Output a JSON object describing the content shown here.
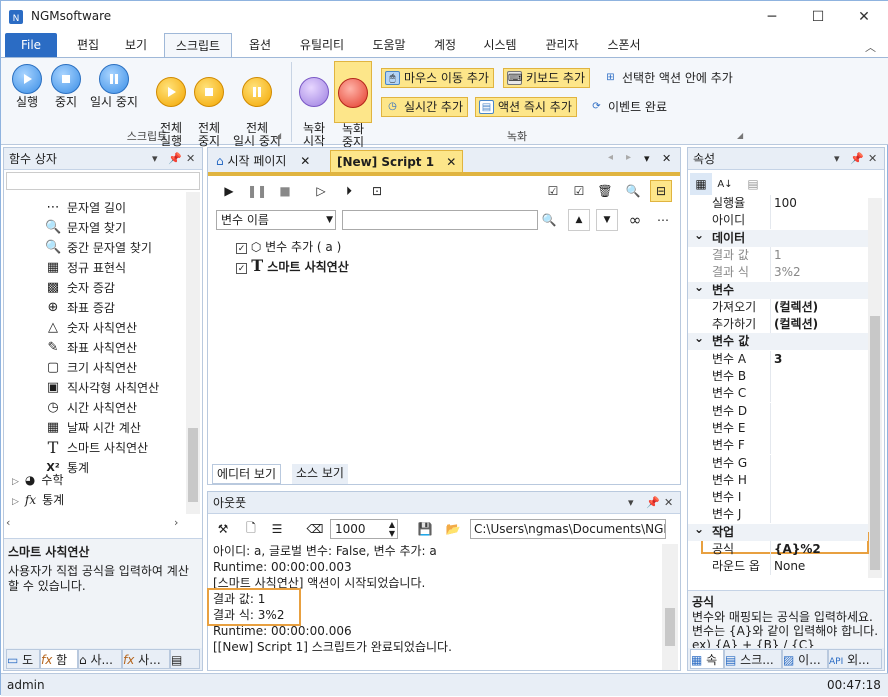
{
  "app": {
    "title": "NGMsoftware",
    "min_icon": "minimize-icon",
    "max_icon": "maximize-icon",
    "close_icon": "close-icon"
  },
  "menu": {
    "items": [
      "File",
      "편집",
      "보기",
      "스크립트",
      "옵션",
      "유틸리티",
      "도움말",
      "계정",
      "시스템",
      "관리자",
      "스폰서"
    ]
  },
  "ribbon": {
    "script_group": {
      "label": "스크립트",
      "run": "실행",
      "stop": "중지",
      "pause": "일시 중지",
      "run_all": "전체\n실행",
      "stop_all": "전체\n중지",
      "pause_all": "전체\n일시 중지"
    },
    "record_group": {
      "label": "녹화",
      "record_start": "녹화\n시작",
      "record_stop": "녹화\n중지",
      "mouse_move": "마우스 이동 추가",
      "keyboard": "키보드 추가",
      "inside_action": "선택한 액션 안에 추가",
      "realtime": "실시간 추가",
      "action_now": "액션 즉시 추가",
      "event_done": "이벤트 완료"
    }
  },
  "left_panel": {
    "title": "함수 상자",
    "search_value": "",
    "items": [
      {
        "icon": "ellipsis-icon",
        "label": "문자열 길이"
      },
      {
        "icon": "search-icon",
        "label": "문자열 찾기"
      },
      {
        "icon": "search-icon",
        "label": "중간 문자열 찾기"
      },
      {
        "icon": "regex-icon",
        "label": "정규 표현식"
      },
      {
        "icon": "grid-icon",
        "label": "숫자 증감"
      },
      {
        "icon": "crosshair-icon",
        "label": "좌표 증감"
      },
      {
        "icon": "triangle-icon",
        "label": "숫자 사칙연산"
      },
      {
        "icon": "pencil-icon",
        "label": "좌표 사칙연산"
      },
      {
        "icon": "square-icon",
        "label": "크기 사칙연산"
      },
      {
        "icon": "rect-icon",
        "label": "직사각형 사칙연산"
      },
      {
        "icon": "clock-icon",
        "label": "시간 사칙연산"
      },
      {
        "icon": "calendar-icon",
        "label": "날짜 시간 계산"
      },
      {
        "icon": "text-icon",
        "label": "스마트 사칙연산"
      },
      {
        "icon": "x2-icon",
        "label": "통계"
      }
    ],
    "groups": [
      {
        "icon": "pie-icon",
        "label": "수학"
      },
      {
        "icon": "fx-icon",
        "label": "통계"
      }
    ],
    "desc_title": "스마트 사칙연산",
    "desc_text": "사용자가 직접 공식을 입력하여 계산할 수 있습니다.",
    "bottom_tabs": [
      "도",
      "함",
      "사...",
      "사...",
      ""
    ]
  },
  "editor": {
    "tabs": [
      "시작 페이지",
      "[New] Script 1"
    ],
    "var_select": "변수 이름",
    "var_search": "",
    "tree": [
      {
        "label": "변수 추가 ( a )",
        "checked": true
      },
      {
        "label": "스마트 사칙연산",
        "checked": true
      }
    ],
    "view_tabs": [
      "에디터 보기",
      "소스 보기"
    ]
  },
  "output": {
    "title": "아웃풋",
    "interval": "1000",
    "path": "C:\\Users\\ngmas\\Documents\\NGM6\\",
    "lines": [
      "아이디: a, 글로벌 변수: False, 변수 추가: a",
      "Runtime: 00:00:00.003",
      "[스마트 사칙연산] 액션이 시작되었습니다.",
      "결과 값: 1",
      "결과 식: 3%2",
      "Runtime: 00:00:00.006",
      "[[New] Script 1] 스크립트가 완료되었습니다."
    ]
  },
  "properties": {
    "title": "속성",
    "rows": [
      {
        "type": "row",
        "key": "실행율",
        "val": "100"
      },
      {
        "type": "row",
        "key": "아이디",
        "val": ""
      },
      {
        "type": "cat",
        "key": "데이터"
      },
      {
        "type": "row",
        "key": "결과 값",
        "val": "1",
        "gray": true
      },
      {
        "type": "row",
        "key": "결과 식",
        "val": "3%2",
        "gray": true
      },
      {
        "type": "cat",
        "key": "변수"
      },
      {
        "type": "row",
        "key": "가져오기",
        "val": "(컬렉션)",
        "bold": true
      },
      {
        "type": "row",
        "key": "추가하기",
        "val": "(컬렉션)",
        "bold": true
      },
      {
        "type": "cat",
        "key": "변수 값"
      },
      {
        "type": "row",
        "key": "변수 A",
        "val": "3",
        "bold": true
      },
      {
        "type": "row",
        "key": "변수 B",
        "val": ""
      },
      {
        "type": "row",
        "key": "변수 C",
        "val": ""
      },
      {
        "type": "row",
        "key": "변수 D",
        "val": ""
      },
      {
        "type": "row",
        "key": "변수 E",
        "val": ""
      },
      {
        "type": "row",
        "key": "변수 F",
        "val": ""
      },
      {
        "type": "row",
        "key": "변수 G",
        "val": ""
      },
      {
        "type": "row",
        "key": "변수 H",
        "val": ""
      },
      {
        "type": "row",
        "key": "변수 I",
        "val": ""
      },
      {
        "type": "row",
        "key": "변수 J",
        "val": ""
      },
      {
        "type": "cat",
        "key": "작업"
      },
      {
        "type": "row",
        "key": "공식",
        "val": "{A}%2",
        "bold": true
      },
      {
        "type": "row",
        "key": "라운드 옵",
        "val": "None"
      }
    ],
    "desc_title": "공식",
    "desc_text": "변수와 매핑되는 공식을 입력하세요. 변수는 {A}와 같이 입력해야 합니다. ex) {A} + {B} / {C}",
    "bottom_tabs": [
      "속",
      "스크...",
      "이...",
      "외..."
    ]
  },
  "status": {
    "user": "admin",
    "time": "00:47:18"
  },
  "colors": {
    "accent": "#2b6cc4",
    "highlight": "#e8a040"
  }
}
